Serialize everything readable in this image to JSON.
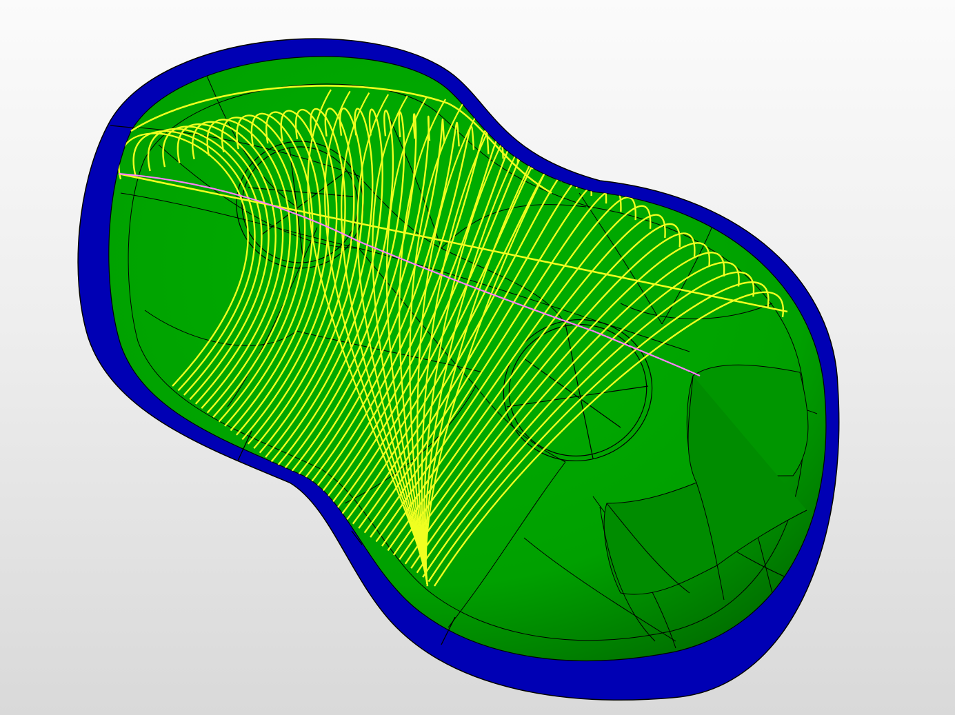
{
  "view": {
    "title": "",
    "background": [
      "#fbfbfb",
      "#d9d9d9"
    ]
  },
  "model": {
    "stock_color": "#0000b4",
    "part_color": "#00a000",
    "edge_color": "#000000",
    "toolpath_color": "#f0ff20",
    "highlight_path_color": "#ff80ff",
    "toolpath_pass_count": 46
  }
}
